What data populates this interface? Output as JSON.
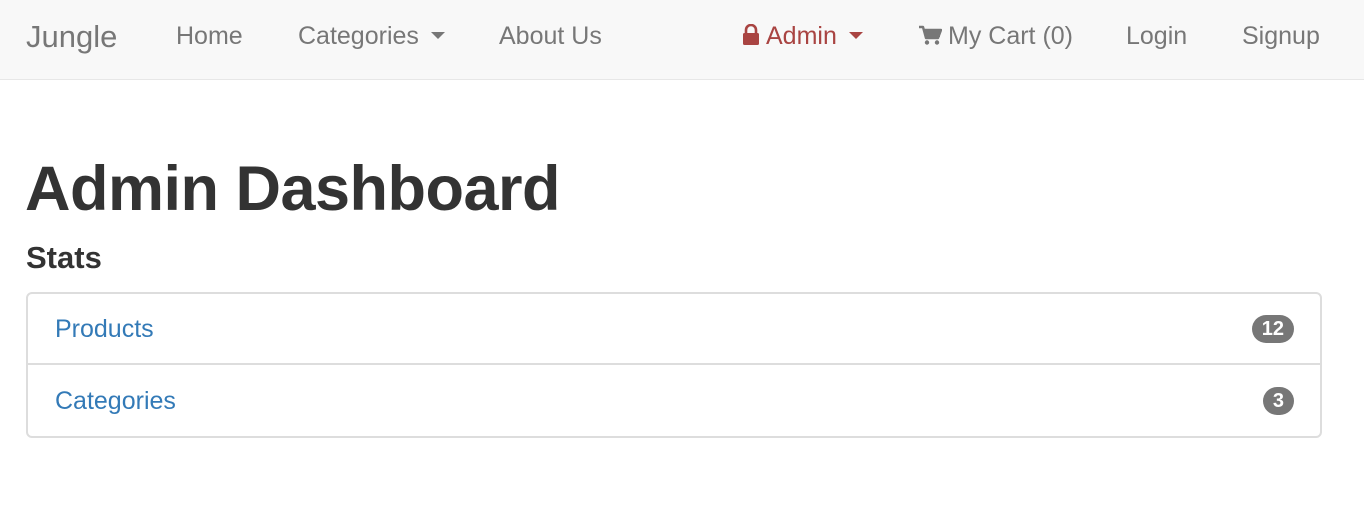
{
  "navbar": {
    "brand": "Jungle",
    "home": "Home",
    "categories": "Categories",
    "about": "About Us",
    "admin": "Admin",
    "cart": "My Cart (0)",
    "login": "Login",
    "signup": "Signup",
    "icons": {
      "admin": "lock-icon",
      "cart": "shopping-cart-icon",
      "dropdown": "caret-down-icon"
    },
    "colors": {
      "background": "#f8f8f8",
      "text": "#777777",
      "admin": "#a94442"
    }
  },
  "page": {
    "title": "Admin Dashboard",
    "section": "Stats"
  },
  "stats": [
    {
      "label": "Products",
      "count": "12"
    },
    {
      "label": "Categories",
      "count": "3"
    }
  ],
  "colors": {
    "link": "#337ab7",
    "badge": "#777777"
  }
}
